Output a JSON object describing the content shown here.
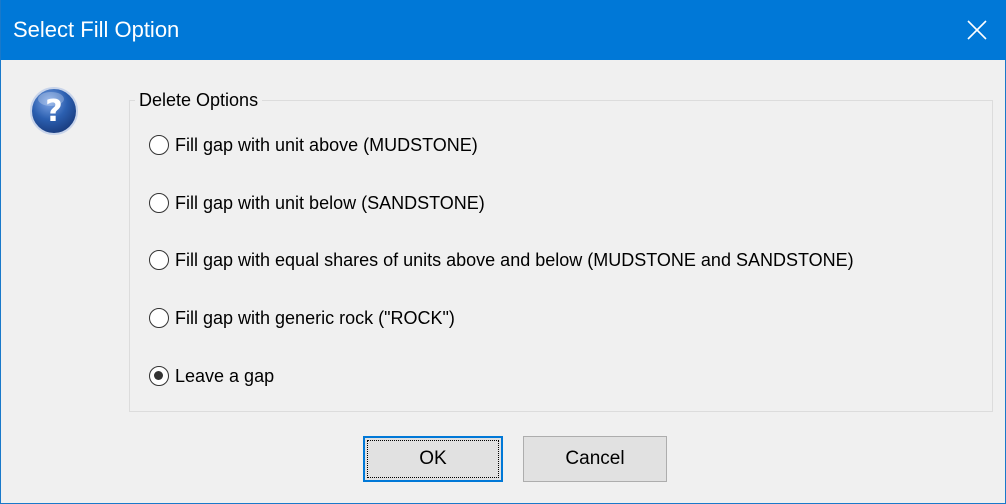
{
  "window": {
    "title": "Select Fill Option"
  },
  "icon": {
    "name": "question-icon",
    "color": "#2b5fb0"
  },
  "group": {
    "legend": "Delete Options",
    "options": [
      {
        "label": "Fill gap with unit above (MUDSTONE)",
        "checked": false
      },
      {
        "label": "Fill gap with unit below (SANDSTONE)",
        "checked": false
      },
      {
        "label": "Fill gap with equal shares of units above and below (MUDSTONE and SANDSTONE)",
        "checked": false
      },
      {
        "label": "Fill gap with generic rock (\"ROCK\")",
        "checked": false
      },
      {
        "label": "Leave a gap",
        "checked": true
      }
    ]
  },
  "buttons": {
    "ok_label": "OK",
    "cancel_label": "Cancel"
  },
  "colors": {
    "titlebar": "#0078d7",
    "window_bg": "#f0f0f0",
    "button_bg": "#e1e1e1",
    "focus_border": "#0078d7"
  }
}
